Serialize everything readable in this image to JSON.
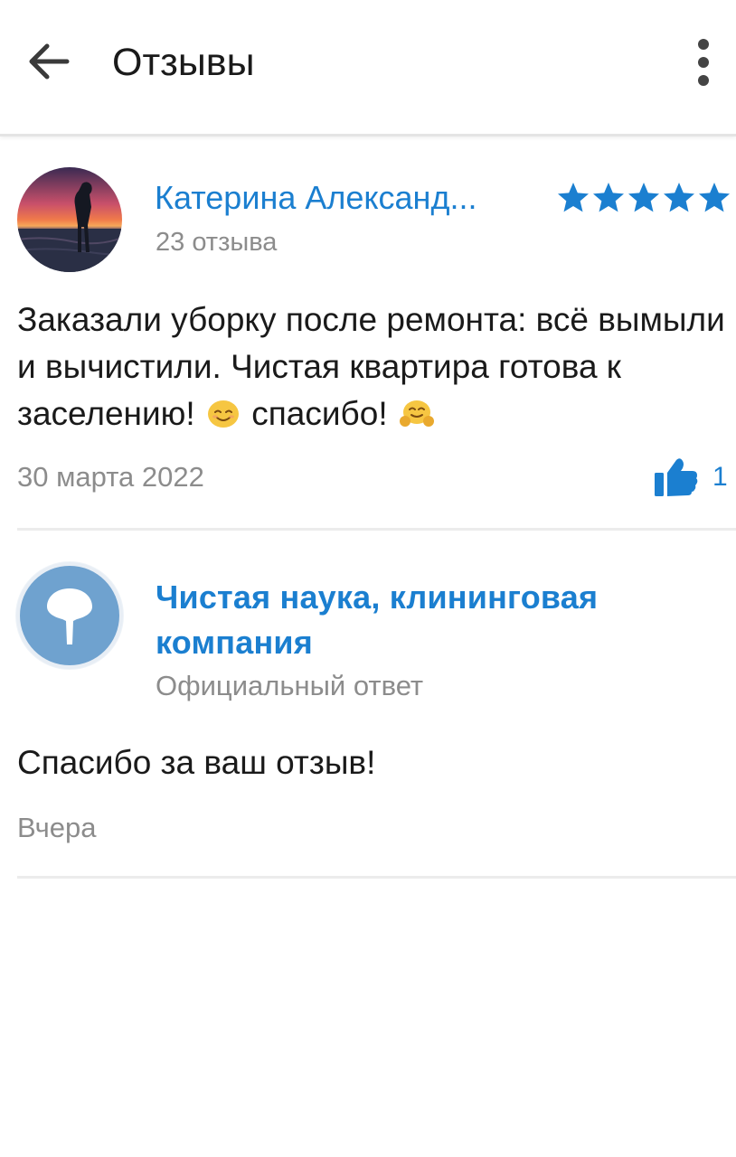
{
  "header": {
    "title": "Отзывы",
    "back_icon": "arrow-left-icon",
    "menu_icon": "more-vertical-icon"
  },
  "review": {
    "author": "Катерина Александ...",
    "review_count": "23 отзыва",
    "rating": 5,
    "rating_max": 5,
    "text_part1": "Заказали уборку после ремонта: всё вымыли и вычистили. Чистая квартира готова к заселению!",
    "text_part2": "спасибо!",
    "emoji_1": "smiling-face-icon",
    "emoji_2": "hugging-face-icon",
    "date": "30 марта 2022",
    "likes": "1"
  },
  "reply": {
    "company": "Чистая наука, клининговая компания",
    "label": "Официальный ответ",
    "text": "Спасибо за ваш отзыв!",
    "date": "Вчера"
  },
  "colors": {
    "accent": "#1b7fd0",
    "star": "#1b7fd0",
    "company_avatar": "#6fa2cf",
    "secondary_text": "#8c8c8c"
  }
}
